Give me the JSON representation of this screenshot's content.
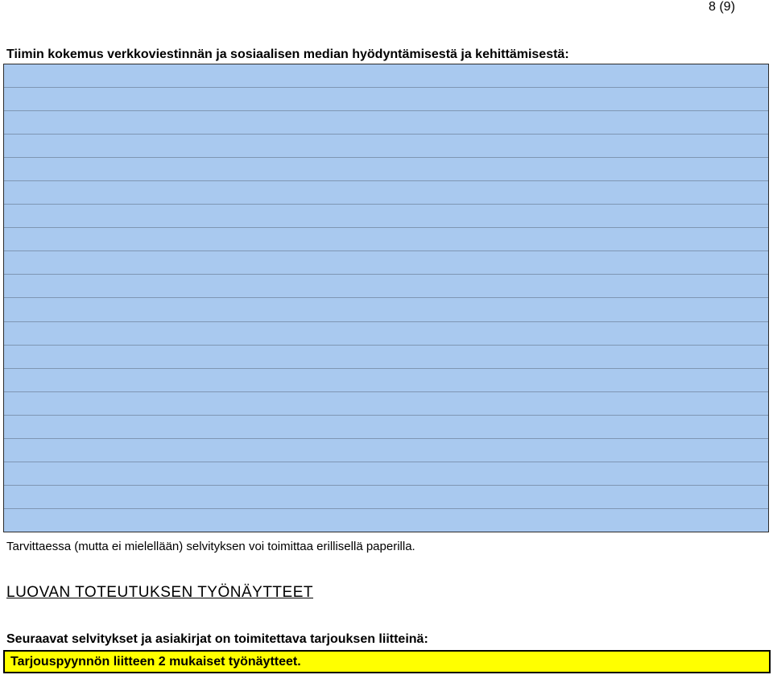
{
  "header": {
    "page_number": "8 (9)"
  },
  "experience_section": {
    "heading": "Tiimin kokemus verkkoviestinnän ja sosiaalisen median hyödyntämisestä ja kehittämisestä:",
    "note": "Tarvittaessa (mutta ei mielellään) selvityksen voi toimittaa erillisellä paperilla.",
    "box_color": "#a9c9ef"
  },
  "samples_section": {
    "heading": "LUOVAN TOTEUTUKSEN TYÖNÄYTTEET",
    "attachments_heading": "Seuraavat selvitykset ja asiakirjat on toimitettava tarjouksen liitteinä:",
    "highlight_text": "Tarjouspyynnön liitteen 2 mukaiset työnäytteet.",
    "highlight_color": "#ffff00"
  }
}
